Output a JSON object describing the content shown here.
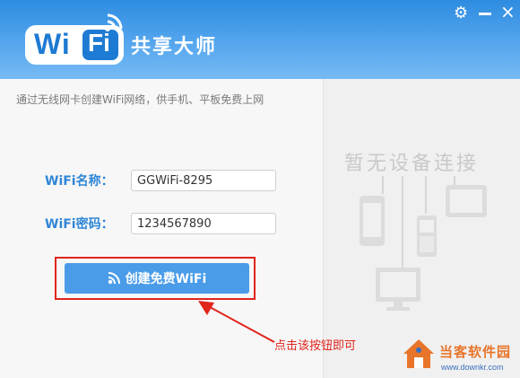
{
  "app": {
    "logo_wi": "Wi",
    "logo_fi": "Fi",
    "title": "共享大师"
  },
  "window_controls": {
    "settings_icon": "gear-icon",
    "minimize_icon": "minimize-icon",
    "close_icon": "close-icon"
  },
  "subtitle": "通过无线网卡创建WiFi网络，供手机、平板免费上网",
  "form": {
    "name_label": "WiFi名称：",
    "name_value": "GGWiFi-8295",
    "password_label": "WiFi密码：",
    "password_value": "1234567890"
  },
  "create_button": {
    "label": "创建免费WiFi",
    "icon": "rss-icon"
  },
  "devices_panel": {
    "empty_text": "暂无设备连接"
  },
  "annotation": {
    "text": "点击该按钮即可",
    "color": "#e0251c"
  },
  "watermark": {
    "text": "当客软件园",
    "url": "www.downkr.com"
  },
  "colors": {
    "header": "#3a96e6",
    "accent": "#4a9ce8",
    "label": "#2f86d6",
    "highlight": "#e0251c"
  }
}
